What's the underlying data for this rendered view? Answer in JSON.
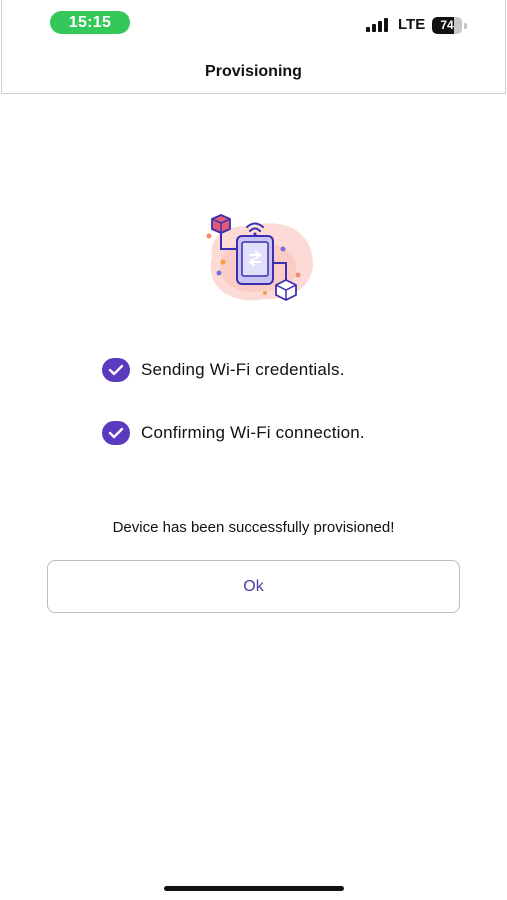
{
  "status_bar": {
    "time": "15:15",
    "network": "LTE",
    "battery_level": 74,
    "battery_text": "74",
    "signal_icon": "cellular-signal-icon",
    "time_pill_color": "#34c759"
  },
  "header": {
    "title": "Provisioning"
  },
  "illustration": {
    "icon": "device-provisioning-illustration"
  },
  "steps": [
    {
      "label": "Sending Wi-Fi credentials.",
      "icon": "checkmark-circle-icon",
      "status": "done"
    },
    {
      "label": "Confirming Wi-Fi connection.",
      "icon": "checkmark-circle-icon",
      "status": "done"
    }
  ],
  "message": "Device has been successfully provisioned!",
  "ok_button": {
    "label": "Ok"
  },
  "colors": {
    "accent": "#5a3bbf",
    "button_text": "#4b3fa0",
    "illustration_blob": "#fbd3cf"
  }
}
